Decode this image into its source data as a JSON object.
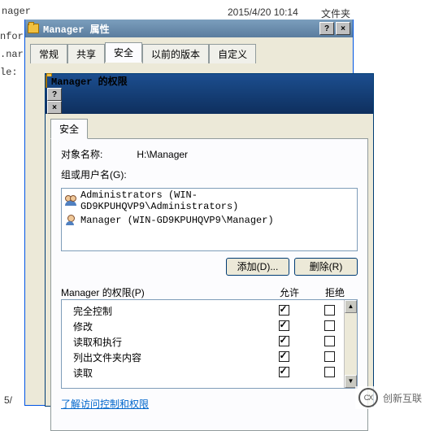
{
  "background": {
    "line1": "nager",
    "line2": "nfor",
    "line3": ".nar",
    "line4": "le:",
    "timestamp": "2015/4/20 10:14",
    "filetype": "文件夹",
    "page_indicator": "5/"
  },
  "dialog1": {
    "title": "Manager 属性",
    "tabs": [
      "常规",
      "共享",
      "安全",
      "以前的版本",
      "自定义"
    ],
    "active_tab_index": 2,
    "help_btn": "?",
    "close_btn": "×"
  },
  "dialog2": {
    "title": "Manager 的权限",
    "tabs": [
      "安全"
    ],
    "help_btn": "?",
    "close_btn": "×",
    "object_label": "对象名称:",
    "object_value": "H:\\Manager",
    "group_users_label": "组或用户名(G):",
    "users": [
      {
        "icon": "group",
        "name": "Administrators (WIN-GD9KPUHQVP9\\Administrators)"
      },
      {
        "icon": "single",
        "name": "Manager (WIN-GD9KPUHQVP9\\Manager)"
      }
    ],
    "add_btn": "添加(D)...",
    "remove_btn": "删除(R)",
    "perm_title": "Manager 的权限(P)",
    "col_allow": "允许",
    "col_deny": "拒绝",
    "permissions": [
      {
        "label": "完全控制",
        "allow": true,
        "deny": false
      },
      {
        "label": "修改",
        "allow": true,
        "deny": false
      },
      {
        "label": "读取和执行",
        "allow": true,
        "deny": false
      },
      {
        "label": "列出文件夹内容",
        "allow": true,
        "deny": false
      },
      {
        "label": "读取",
        "allow": true,
        "deny": false
      }
    ],
    "learn_link": "了解访问控制和权限"
  },
  "watermark": {
    "text": "创新互联",
    "logo": "CX"
  }
}
